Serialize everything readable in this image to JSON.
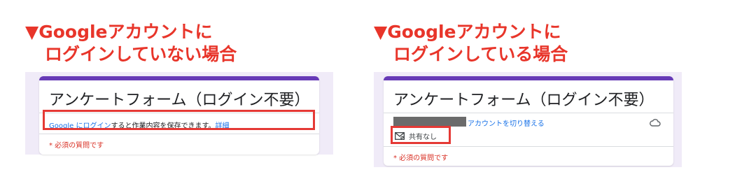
{
  "left": {
    "heading_line1": "▼Googleアカウントに",
    "heading_line2": "ログインしていない場合",
    "form_title": "アンケートフォーム（ログイン不要）",
    "login_note_prefix": "Google にログイン",
    "login_note_middle": "すると作業内容を保存できます。",
    "login_note_link": "詳細",
    "required_note": "* 必須の質問です"
  },
  "right": {
    "heading_line1": "▼Googleアカウントに",
    "heading_line2": "ログインしている場合",
    "form_title": "アンケートフォーム（ログイン不要）",
    "switch_account": "アカウントを切り替える",
    "share_status": "共有なし",
    "required_note": "* 必須の質問です"
  },
  "colors": {
    "heading": "#e8352a",
    "accent_bar": "#673ab7",
    "highlight_box": "#e53935",
    "link": "#1a73e8"
  },
  "icons": [
    "cloud-icon",
    "no-share-mail-icon"
  ]
}
